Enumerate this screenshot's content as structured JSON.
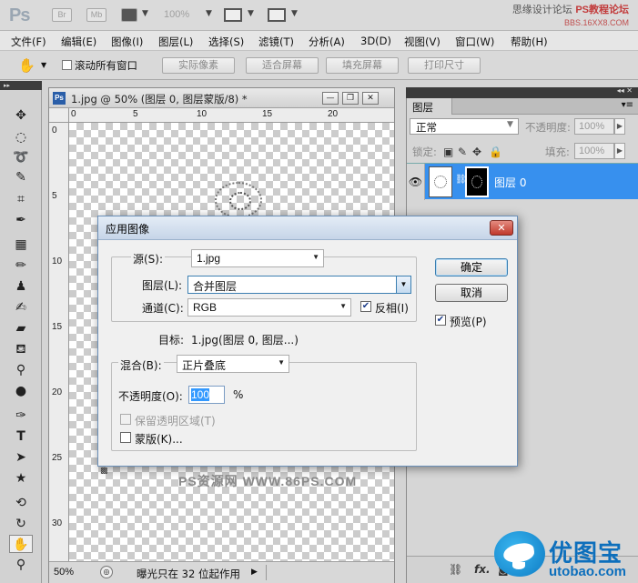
{
  "app": {
    "logo": "Ps",
    "bar_buttons": [
      "Br",
      "Mb"
    ],
    "zoom": "100%",
    "watermark_top": [
      "思缘设计论坛",
      "PS教程论坛",
      "BBS.16XX8.COM"
    ]
  },
  "menu": [
    "文件(F)",
    "编辑(E)",
    "图像(I)",
    "图层(L)",
    "选择(S)",
    "滤镜(T)",
    "分析(A)",
    "3D(D)",
    "视图(V)",
    "窗口(W)",
    "帮助(H)"
  ],
  "options": {
    "scroll_all": "滚动所有窗口",
    "buttons": [
      "实际像素",
      "适合屏幕",
      "填充屏幕",
      "打印尺寸"
    ]
  },
  "document": {
    "title": "1.jpg @ 50% (图层 0, 图层蒙版/8) *",
    "ruler_h": [
      "0",
      "5",
      "10",
      "15",
      "20"
    ],
    "ruler_v": [
      "0",
      "5",
      "10",
      "15",
      "20",
      "25",
      "30"
    ],
    "canvas_watermark": "PS资源网 WWW.86PS.COM",
    "status_zoom": "50%",
    "status_text": "曝光只在 32 位起作用"
  },
  "layers": {
    "tab": "图层",
    "blend_mode": "正常",
    "opacity_label": "不透明度:",
    "opacity_value": "100%",
    "lock_label": "锁定:",
    "fill_label": "填充:",
    "fill_value": "100%",
    "layer_name": "图层 0"
  },
  "watermark_br": {
    "brand": "优图宝",
    "url": "utobao.com"
  },
  "dialog": {
    "title": "应用图像",
    "source_label": "源(S):",
    "source_value": "1.jpg",
    "layer_label": "图层(L):",
    "layer_value": "合并图层",
    "channel_label": "通道(C):",
    "channel_value": "RGB",
    "invert_label": "反相(I)",
    "invert_checked": true,
    "target_label": "目标:",
    "target_value": "1.jpg(图层 0, 图层...)",
    "blending_label": "混合(B):",
    "blending_value": "正片叠底",
    "opacity_label": "不透明度(O):",
    "opacity_value": "100",
    "opacity_unit": "%",
    "preserve_label": "保留透明区域(T)",
    "preserve_checked": false,
    "mask_label": "蒙版(K)...",
    "mask_checked": false,
    "ok": "确定",
    "cancel": "取消",
    "preview_label": "预览(P)",
    "preview_checked": true
  },
  "colors": {
    "accent": "#3790ee",
    "close_button": "#c0392b"
  }
}
